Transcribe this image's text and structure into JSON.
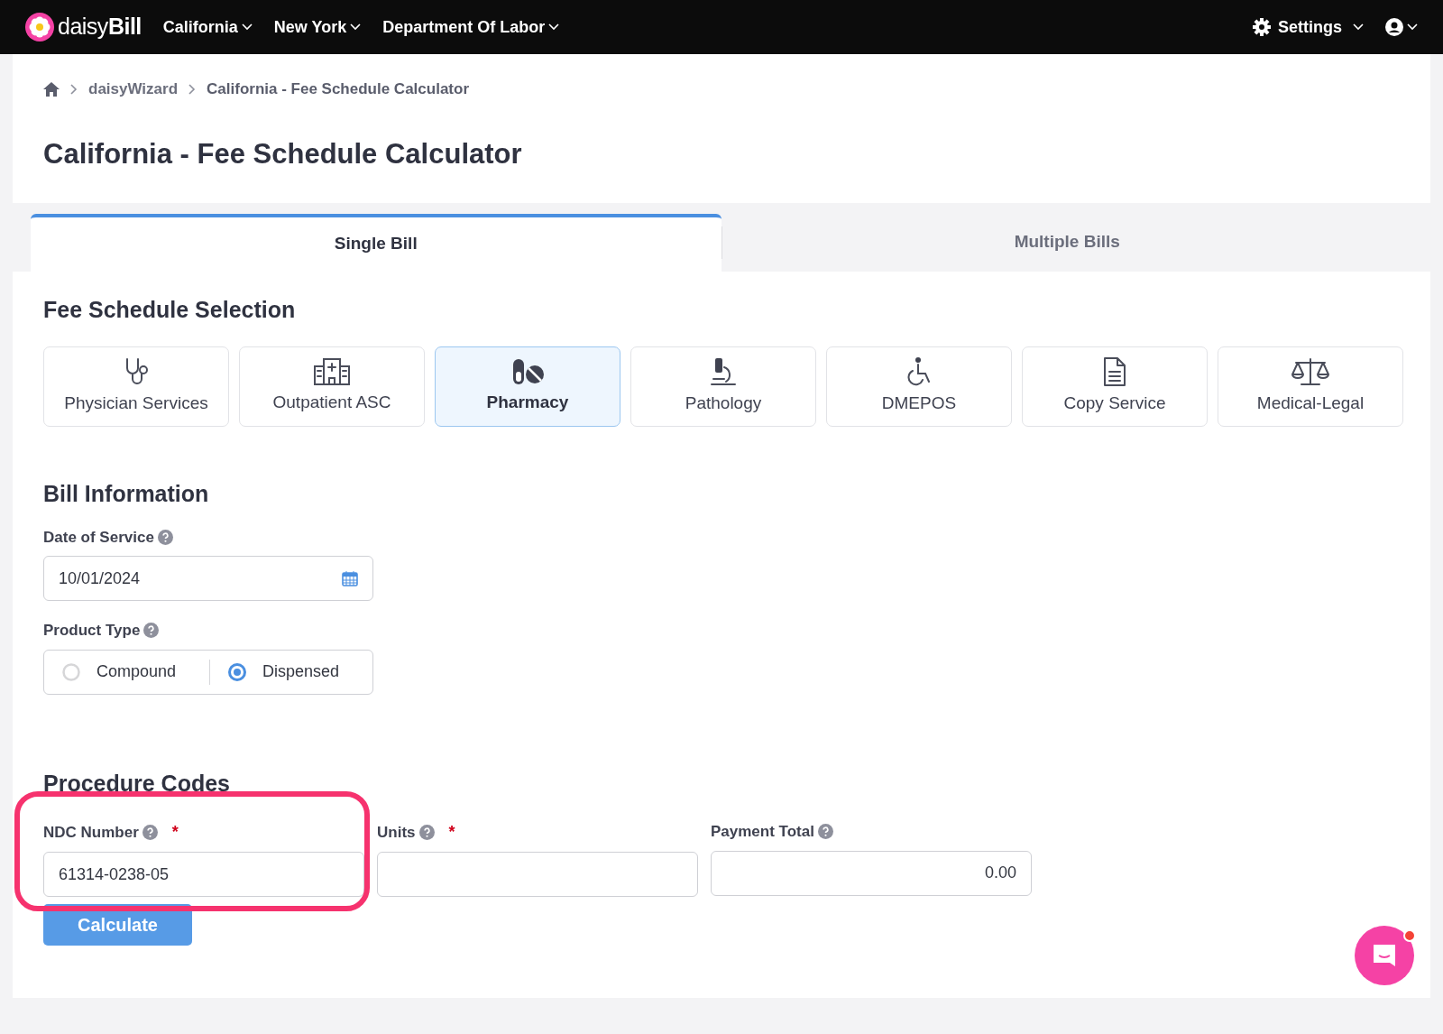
{
  "navbar": {
    "brand_light": "daisy",
    "brand_bold": "Bill",
    "menus": [
      {
        "label": "California"
      },
      {
        "label": "New York"
      },
      {
        "label": "Department Of Labor"
      }
    ],
    "settings": {
      "label": "Settings"
    }
  },
  "breadcrumb": [
    {
      "label": "daisyWizard"
    },
    {
      "label": "California - Fee Schedule Calculator"
    }
  ],
  "page_title": "California - Fee Schedule Calculator",
  "tabs": [
    {
      "label": "Single Bill",
      "selected": true
    },
    {
      "label": "Multiple Bills",
      "selected": false
    }
  ],
  "fee_schedule": {
    "heading": "Fee Schedule Selection",
    "options": [
      {
        "label": "Physician Services",
        "selected": false
      },
      {
        "label": "Outpatient ASC",
        "selected": false
      },
      {
        "label": "Pharmacy",
        "selected": true
      },
      {
        "label": "Pathology",
        "selected": false
      },
      {
        "label": "DMEPOS",
        "selected": false
      },
      {
        "label": "Copy Service",
        "selected": false
      },
      {
        "label": "Medical-Legal",
        "selected": false
      }
    ]
  },
  "bill_information": {
    "heading": "Bill Information",
    "date_of_service": {
      "label": "Date of Service",
      "value": "10/01/2024"
    },
    "product_type": {
      "label": "Product Type",
      "options": [
        {
          "label": "Compound",
          "selected": false
        },
        {
          "label": "Dispensed",
          "selected": true
        }
      ]
    }
  },
  "procedure_codes": {
    "heading": "Procedure Codes",
    "fields": [
      {
        "kind": "text",
        "label": "NDC Number",
        "required_mark": "*",
        "value": "61314-0238-05",
        "highlighted": true
      },
      {
        "kind": "text",
        "label": "Units",
        "required_mark": "*",
        "highlighted": false
      },
      {
        "kind": "amount",
        "label": "Payment Total",
        "value": "0.00",
        "highlighted": false
      }
    ],
    "button": "Calculate"
  },
  "chat": {
    "unread": true
  }
}
